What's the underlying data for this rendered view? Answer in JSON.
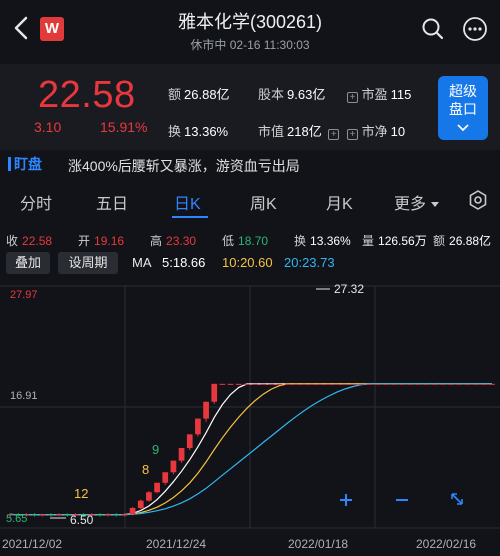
{
  "header": {
    "title": "雅本化学(300261)",
    "subtitle": "休市中 02-16 11:30:03",
    "app_logo": "W"
  },
  "quote": {
    "price": "22.58",
    "change": "3.10",
    "change_pct": "15.91%",
    "amount_label": "额",
    "amount": "26.88亿",
    "capital_label": "股本",
    "capital": "9.63亿",
    "pe_label": "市盈",
    "pe": "115",
    "turnover_label": "换",
    "turnover": "13.36%",
    "mktcap_label": "市值",
    "mktcap": "218亿",
    "pb_label": "市净",
    "pb": "10",
    "super_btn_line1": "超级",
    "super_btn_line2": "盘口"
  },
  "news": {
    "tag": "盯盘",
    "text": "涨400%后腰斩又暴涨，游资血亏出局"
  },
  "tabs": {
    "items": [
      "分时",
      "五日",
      "日K",
      "周K",
      "月K",
      "更多"
    ],
    "active": "日K"
  },
  "stats": {
    "close_label": "收",
    "close": "22.58",
    "open_label": "开",
    "open": "19.16",
    "high_label": "高",
    "high": "23.30",
    "low_label": "低",
    "low": "18.70",
    "turn_label": "换",
    "turn": "13.36%",
    "vol_label": "量",
    "vol": "126.56万",
    "amt_label": "额",
    "amt": "26.88亿"
  },
  "controls": {
    "overlay": "叠加",
    "period": "设周期",
    "ma_label": "MA",
    "ma5": "5:18.66",
    "ma10": "10:20.60",
    "ma20": "20:23.73"
  },
  "colors": {
    "up": "#e8383d",
    "down": "#2bb673",
    "ma5": "#ffffff",
    "ma10": "#f5c242",
    "ma20": "#2fb6f0",
    "accent": "#2e86ff"
  },
  "chart_data": {
    "type": "candlestick",
    "y_axis_labels": [
      "27.97",
      "16.91"
    ],
    "x_axis_labels": [
      "2021/12/02",
      "2021/12/24",
      "2022/01/18",
      "2022/02/16"
    ],
    "annotations": {
      "max_label": "27.32",
      "min_label": "6.50",
      "bottom_left": "5.65"
    },
    "markers": [
      "12",
      "8",
      "9"
    ],
    "candles": [
      {
        "o": 6.7,
        "c": 6.8,
        "h": 6.9,
        "l": 6.5
      },
      {
        "o": 6.8,
        "c": 6.7,
        "h": 6.9,
        "l": 6.6
      },
      {
        "o": 6.7,
        "c": 6.8,
        "h": 6.9,
        "l": 6.6
      },
      {
        "o": 6.8,
        "c": 6.7,
        "h": 6.9,
        "l": 6.6
      },
      {
        "o": 6.7,
        "c": 6.8,
        "h": 6.85,
        "l": 6.6
      },
      {
        "o": 6.8,
        "c": 6.75,
        "h": 6.9,
        "l": 6.6
      },
      {
        "o": 6.75,
        "c": 6.8,
        "h": 6.9,
        "l": 6.65
      },
      {
        "o": 6.8,
        "c": 6.7,
        "h": 6.9,
        "l": 6.6
      },
      {
        "o": 6.7,
        "c": 6.8,
        "h": 6.9,
        "l": 6.6
      },
      {
        "o": 6.8,
        "c": 6.75,
        "h": 6.9,
        "l": 6.6
      },
      {
        "o": 6.75,
        "c": 6.8,
        "h": 6.9,
        "l": 6.6
      },
      {
        "o": 6.8,
        "c": 6.7,
        "h": 6.9,
        "l": 6.6
      },
      {
        "o": 6.7,
        "c": 6.8,
        "h": 6.9,
        "l": 6.6
      },
      {
        "o": 6.8,
        "c": 6.75,
        "h": 6.9,
        "l": 6.6
      },
      {
        "o": 6.75,
        "c": 6.8,
        "h": 6.9,
        "l": 6.6
      },
      {
        "o": 6.8,
        "c": 7.4,
        "h": 7.5,
        "l": 6.7
      },
      {
        "o": 7.4,
        "c": 8.1,
        "h": 8.2,
        "l": 7.3
      },
      {
        "o": 8.1,
        "c": 8.9,
        "h": 9.0,
        "l": 8.0
      },
      {
        "o": 8.9,
        "c": 9.8,
        "h": 9.8,
        "l": 8.8
      },
      {
        "o": 9.8,
        "c": 10.8,
        "h": 10.8,
        "l": 9.6
      },
      {
        "o": 10.8,
        "c": 11.9,
        "h": 11.9,
        "l": 10.6
      },
      {
        "o": 11.9,
        "c": 13.1,
        "h": 13.1,
        "l": 11.7
      },
      {
        "o": 13.1,
        "c": 14.4,
        "h": 14.4,
        "l": 12.9
      },
      {
        "o": 14.4,
        "c": 15.9,
        "h": 15.9,
        "l": 14.2
      },
      {
        "o": 15.9,
        "c": 17.5,
        "h": 17.5,
        "l": 15.6
      },
      {
        "o": 17.5,
        "c": 19.2,
        "h": 19.2,
        "l": 17.3
      },
      {
        "o": 19.2,
        "c": 19.2,
        "h": 19.2,
        "l": 19.2
      },
      {
        "o": 19.2,
        "c": 19.2,
        "h": 19.2,
        "l": 19.2
      },
      {
        "o": 19.2,
        "c": 19.2,
        "h": 19.2,
        "l": 19.2
      },
      {
        "o": 19.2,
        "c": 19.2,
        "h": 19.2,
        "l": 19.2
      },
      {
        "o": 19.2,
        "c": 19.2,
        "h": 19.2,
        "l": 19.2
      },
      {
        "o": 19.2,
        "c": 19.2,
        "h": 19.2,
        "l": 19.2
      },
      {
        "o": 19.2,
        "c": 19.2,
        "h": 19.2,
        "l": 19.2
      },
      {
        "o": 19.2,
        "c": 19.2,
        "h": 19.2,
        "l": 19.2
      },
      {
        "o": 19.2,
        "c": 19.2,
        "h": 19.2,
        "l": 19.2
      },
      {
        "o": 19.2,
        "c": 19.2,
        "h": 19.2,
        "l": 19.2
      },
      {
        "o": 19.2,
        "c": 19.2,
        "h": 19.2,
        "l": 19.2
      },
      {
        "o": 19.2,
        "c": 19.2,
        "h": 19.2,
        "l": 19.2
      },
      {
        "o": 19.2,
        "c": 19.2,
        "h": 19.2,
        "l": 19.2
      },
      {
        "o": 19.2,
        "c": 19.2,
        "h": 19.2,
        "l": 19.2
      },
      {
        "o": 19.2,
        "c": 19.2,
        "h": 19.2,
        "l": 19.2
      },
      {
        "o": 19.2,
        "c": 19.2,
        "h": 19.2,
        "l": 19.2
      },
      {
        "o": 19.2,
        "c": 19.2,
        "h": 19.2,
        "l": 19.2
      },
      {
        "o": 19.2,
        "c": 19.2,
        "h": 19.2,
        "l": 19.2
      },
      {
        "o": 19.2,
        "c": 19.2,
        "h": 19.2,
        "l": 19.2
      },
      {
        "o": 19.2,
        "c": 19.2,
        "h": 19.2,
        "l": 19.2
      },
      {
        "o": 19.2,
        "c": 19.2,
        "h": 19.2,
        "l": 19.2
      },
      {
        "o": 19.2,
        "c": 19.2,
        "h": 19.2,
        "l": 19.2
      },
      {
        "o": 19.2,
        "c": 19.2,
        "h": 19.2,
        "l": 19.2
      },
      {
        "o": 19.2,
        "c": 19.2,
        "h": 19.2,
        "l": 19.2
      },
      {
        "o": 19.2,
        "c": 19.2,
        "h": 19.2,
        "l": 19.2
      },
      {
        "o": 19.2,
        "c": 19.2,
        "h": 19.2,
        "l": 19.2
      },
      {
        "o": 19.2,
        "c": 19.2,
        "h": 19.2,
        "l": 19.2
      },
      {
        "o": 19.2,
        "c": 19.2,
        "h": 19.2,
        "l": 19.2
      },
      {
        "o": 19.2,
        "c": 19.2,
        "h": 19.2,
        "l": 19.2
      },
      {
        "o": 19.2,
        "c": 19.2,
        "h": 19.2,
        "l": 19.2
      },
      {
        "o": 19.2,
        "c": 19.2,
        "h": 19.2,
        "l": 19.2
      },
      {
        "o": 19.2,
        "c": 19.2,
        "h": 19.2,
        "l": 19.2
      },
      {
        "o": 19.2,
        "c": 19.2,
        "h": 19.2,
        "l": 19.2
      },
      {
        "o": 19.2,
        "c": 19.2,
        "h": 19.2,
        "l": 19.2
      }
    ]
  }
}
